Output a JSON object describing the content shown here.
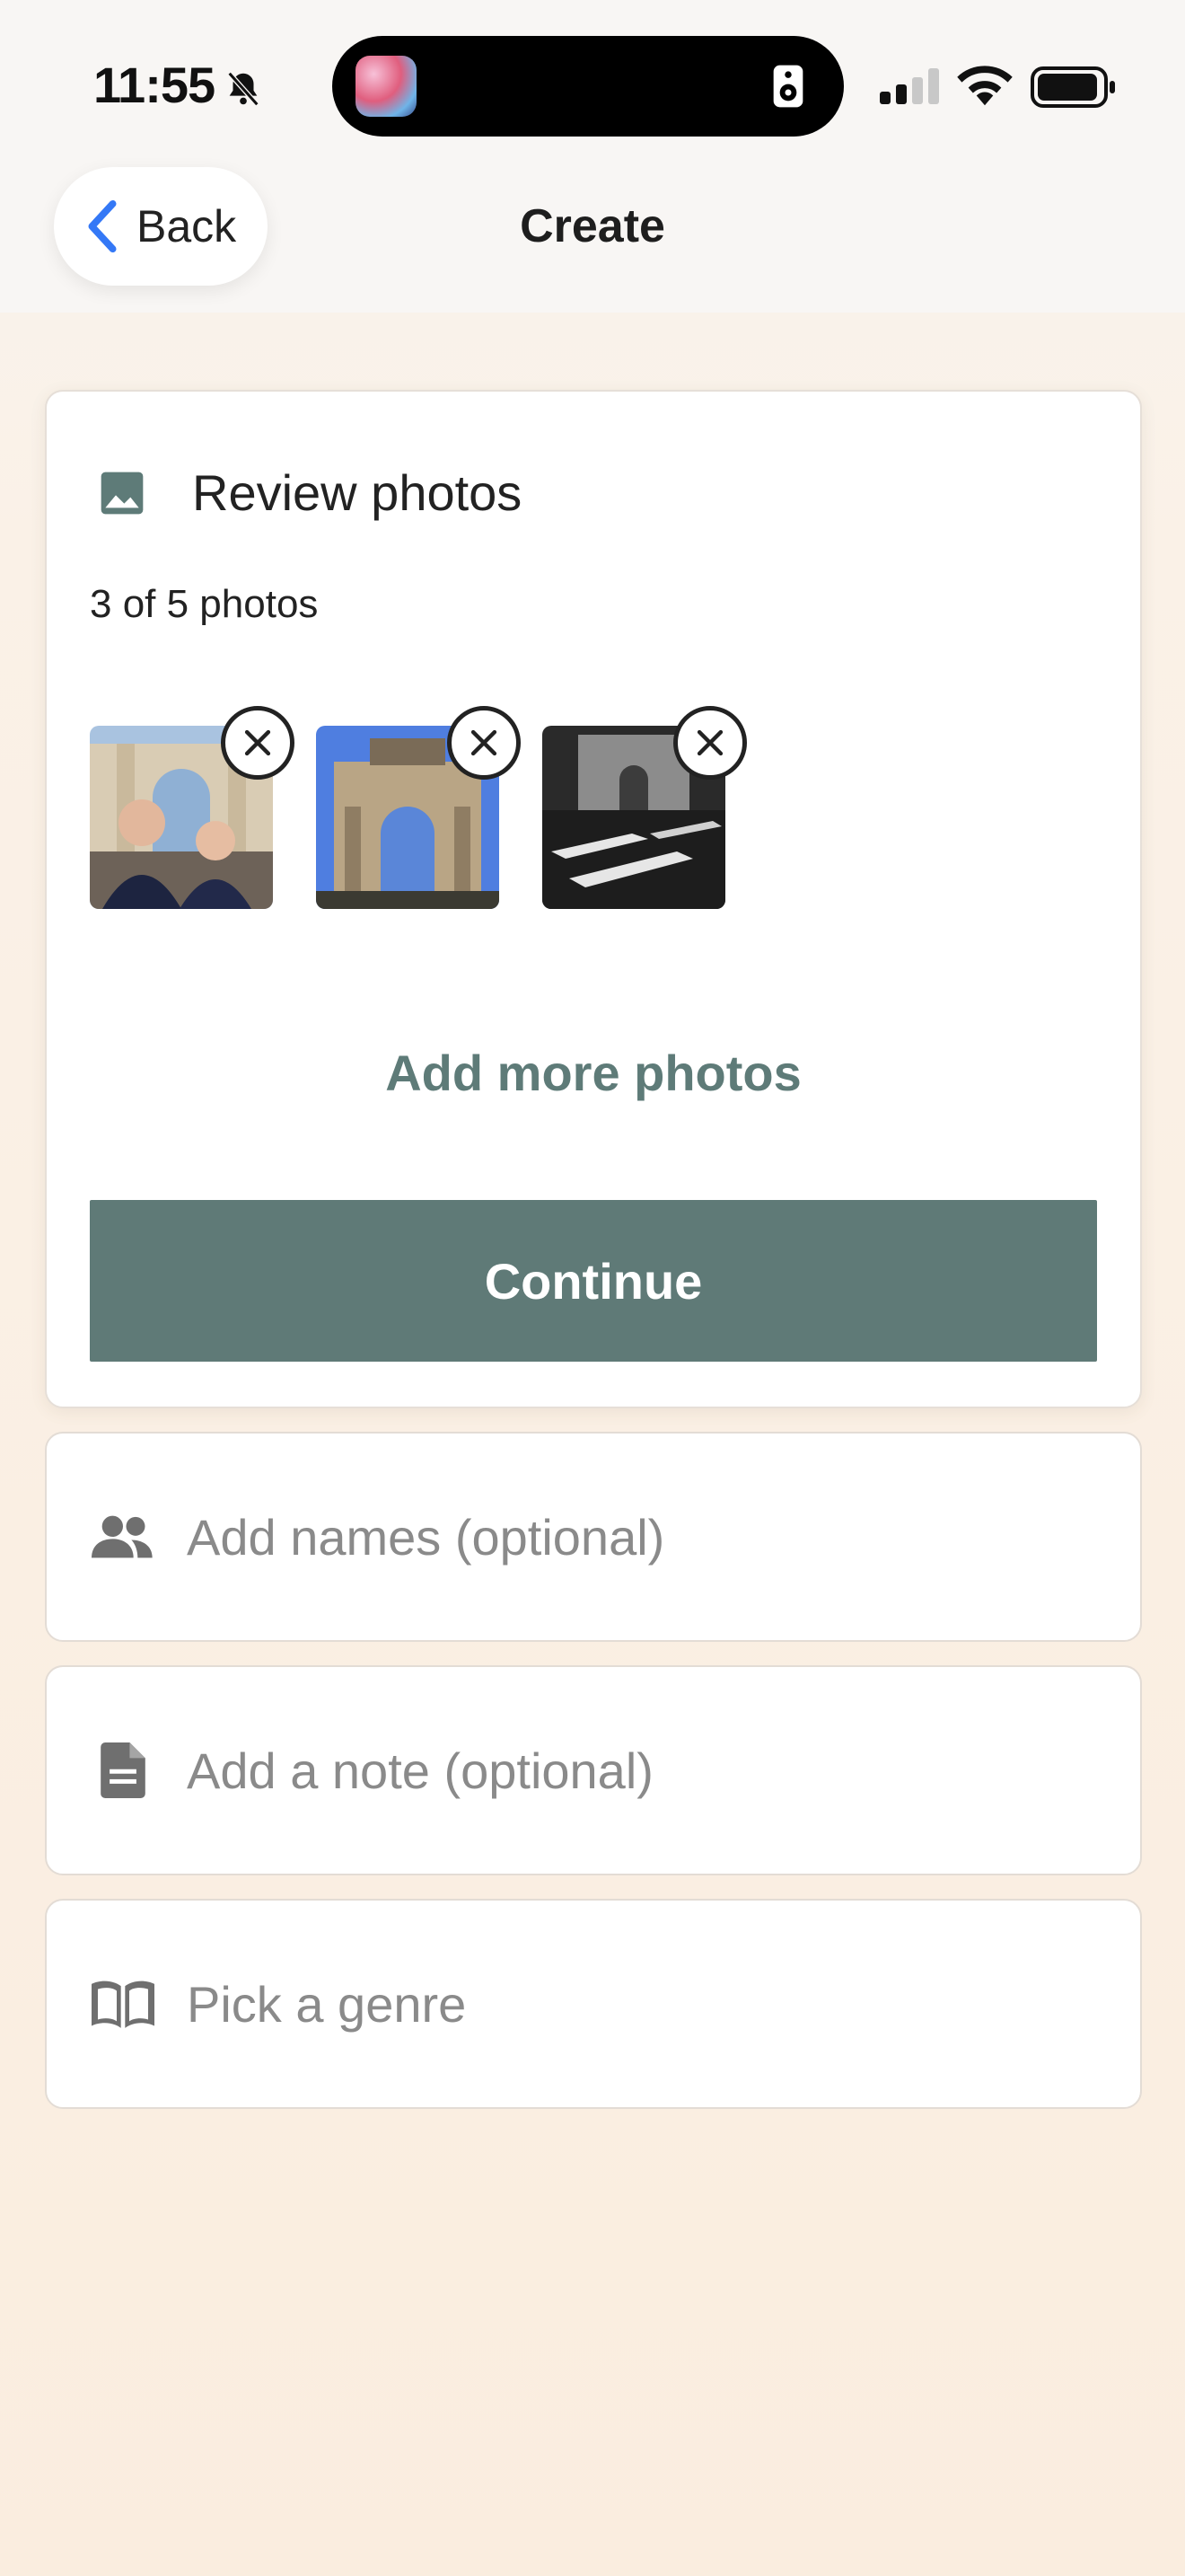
{
  "status_bar": {
    "time": "11:55"
  },
  "nav": {
    "back_label": "Back",
    "title": "Create"
  },
  "review": {
    "title": "Review photos",
    "count_text": "3 of 5 photos",
    "add_more_label": "Add more photos",
    "continue_label": "Continue"
  },
  "options": {
    "names_placeholder": "Add names (optional)",
    "note_placeholder": "Add a note (optional)",
    "genre_placeholder": "Pick a genre"
  },
  "colors": {
    "accent": "#5f7a77",
    "back_chevron": "#3478f6",
    "placeholder_text": "#8a8a8a"
  }
}
